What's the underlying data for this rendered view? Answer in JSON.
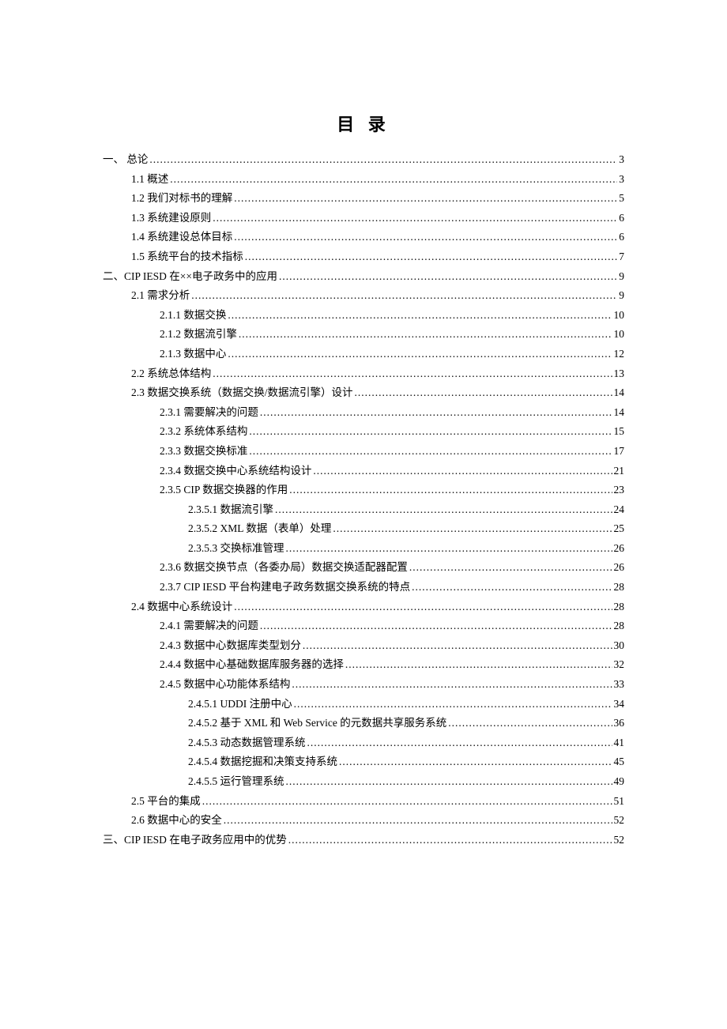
{
  "title": "目  录",
  "entries": [
    {
      "level": 0,
      "label": "一、        总论",
      "page": "3",
      "firstChap": true
    },
    {
      "level": 1,
      "label": "1.1 概述",
      "page": "3"
    },
    {
      "level": 1,
      "label": "1.2 我们对标书的理解",
      "page": "5"
    },
    {
      "level": 1,
      "label": "1.3 系统建设原则",
      "page": "6"
    },
    {
      "level": 1,
      "label": "1.4 系统建设总体目标",
      "page": "6"
    },
    {
      "level": 1,
      "label": "1.5 系统平台的技术指标",
      "page": "7"
    },
    {
      "level": 0,
      "label": "二、CIP IESD 在××电子政务中的应用",
      "page": "9"
    },
    {
      "level": 1,
      "label": "2.1 需求分析",
      "page": "9"
    },
    {
      "level": 2,
      "label": "2.1.1 数据交换",
      "page": "10"
    },
    {
      "level": 2,
      "label": "2.1.2 数据流引擎",
      "page": "10"
    },
    {
      "level": 2,
      "label": "2.1.3 数据中心",
      "page": "12"
    },
    {
      "level": 1,
      "label": "2.2  系统总体结构",
      "page": "13"
    },
    {
      "level": 1,
      "label": "2.3 数据交换系统（数据交换/数据流引擎）设计",
      "page": "14"
    },
    {
      "level": 2,
      "label": "2.3.1 需要解决的问题",
      "page": "14"
    },
    {
      "level": 2,
      "label": "2.3.2  系统体系结构",
      "page": "15"
    },
    {
      "level": 2,
      "label": "2.3.3 数据交换标准",
      "page": "17"
    },
    {
      "level": 2,
      "label": "2.3.4 数据交换中心系统结构设计",
      "page": "21"
    },
    {
      "level": 2,
      "label": "2.3.5 CIP 数据交换器的作用",
      "page": "23"
    },
    {
      "level": 3,
      "label": "2.3.5.1 数据流引擎",
      "page": "24"
    },
    {
      "level": 3,
      "label": "2.3.5.2 XML 数据（表单）处理",
      "page": "25"
    },
    {
      "level": 3,
      "label": "2.3.5.3 交换标准管理",
      "page": "26"
    },
    {
      "level": 2,
      "label": "2.3.6 数据交换节点（各委办局）数据交换适配器配置",
      "page": "26"
    },
    {
      "level": 2,
      "label": "2.3.7 CIP IESD 平台构建电子政务数据交换系统的特点",
      "page": "28"
    },
    {
      "level": 1,
      "label": "2.4 数据中心系统设计",
      "page": "28"
    },
    {
      "level": 2,
      "label": "2.4.1 需要解决的问题",
      "page": "28"
    },
    {
      "level": 2,
      "label": "2.4.3 数据中心数据库类型划分",
      "page": "30"
    },
    {
      "level": 2,
      "label": "2.4.4 数据中心基础数据库服务器的选择",
      "page": "32"
    },
    {
      "level": 2,
      "label": "2.4.5  数据中心功能体系结构",
      "page": "33"
    },
    {
      "level": 3,
      "label": "2.4.5.1 UDDI 注册中心",
      "page": "34"
    },
    {
      "level": 3,
      "label": "2.4.5.2 基于 XML 和 Web Service 的元数据共享服务系统",
      "page": "36"
    },
    {
      "level": 3,
      "label": "2.4.5.3 动态数据管理系统",
      "page": "41"
    },
    {
      "level": 3,
      "label": "2.4.5.4  数据挖掘和决策支持系统",
      "page": "45"
    },
    {
      "level": 3,
      "label": "2.4.5.5 运行管理系统",
      "page": "49"
    },
    {
      "level": 1,
      "label": "2.5 平台的集成",
      "page": "51"
    },
    {
      "level": 1,
      "label": "2.6 数据中心的安全",
      "page": "52"
    },
    {
      "level": 0,
      "label": "三、CIP IESD 在电子政务应用中的优势",
      "page": "52"
    }
  ]
}
